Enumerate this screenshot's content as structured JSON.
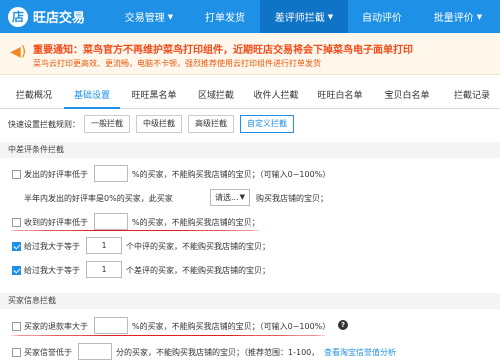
{
  "header": {
    "brand": "旺店交易",
    "nav": [
      {
        "label": "交易管理",
        "has_caret": true
      },
      {
        "label": "打单发货",
        "has_caret": false
      },
      {
        "label": "差评师拦截",
        "has_caret": true
      },
      {
        "label": "自动评价",
        "has_caret": false
      },
      {
        "label": "批量评价",
        "has_caret": true
      }
    ]
  },
  "notice": {
    "line1": "重要通知：菜鸟官方不再维护菜鸟打印组件，近期旺店交易将会下掉菜鸟电子面单打印",
    "line2": "菜鸟云打印更高效、更流畅，电脑不卡顿，强烈推荐使用云打印组件进行打单发货"
  },
  "tabs": [
    "拦截概况",
    "基础设置",
    "旺旺黑名单",
    "区域拦截",
    "收件人拦截",
    "旺旺白名单",
    "宝贝白名单",
    "拦截记录"
  ],
  "quick": {
    "label": "快速设置拦截规则：",
    "buttons": [
      "一般拦截",
      "中级拦截",
      "高级拦截",
      "自定义拦截"
    ]
  },
  "sections": {
    "review": "中差评条件拦截",
    "buyer": "买家信息拦截"
  },
  "rows": {
    "r1": {
      "prefix": "发出的好评率低于",
      "value": "",
      "suffix": "%的买家，不能购买我店铺的宝贝；（可输入0~100%）"
    },
    "r2": {
      "prefix": "半年内发出的好评率是0%的买家，此买家",
      "select": "请选...",
      "suffix": "购买我店铺的宝贝；"
    },
    "r3": {
      "prefix": "收到的好评率低于",
      "value": "",
      "suffix": "%的买家，不能购买我店铺的宝贝；"
    },
    "r4": {
      "prefix": "给过我大于等于",
      "value": "1",
      "suffix": "个中评的买家，不能购买我店铺的宝贝；"
    },
    "r5": {
      "prefix": "给过我大于等于",
      "value": "1",
      "suffix": "个差评的买家，不能购买我店铺的宝贝；"
    },
    "r6": {
      "prefix": "买家的退款率大于",
      "value": "",
      "suffix": "%的买家，不能购买我店铺的宝贝；（可输入0~100%）",
      "help": "?"
    },
    "r7": {
      "prefix": "买家信誉低于",
      "value": "",
      "suffix": "分的买家，不能购买我店铺的宝贝；（推荐范围：1-100，",
      "link": "查看淘宝信誉值分析"
    }
  },
  "icons": {
    "notice": "megaphone-icon",
    "help": "question-icon",
    "logo": "store-logo-icon"
  },
  "colors": {
    "brand_blue": "#1e90e6",
    "notice_red": "#f04c1a",
    "annotation_red": "#d22222"
  }
}
